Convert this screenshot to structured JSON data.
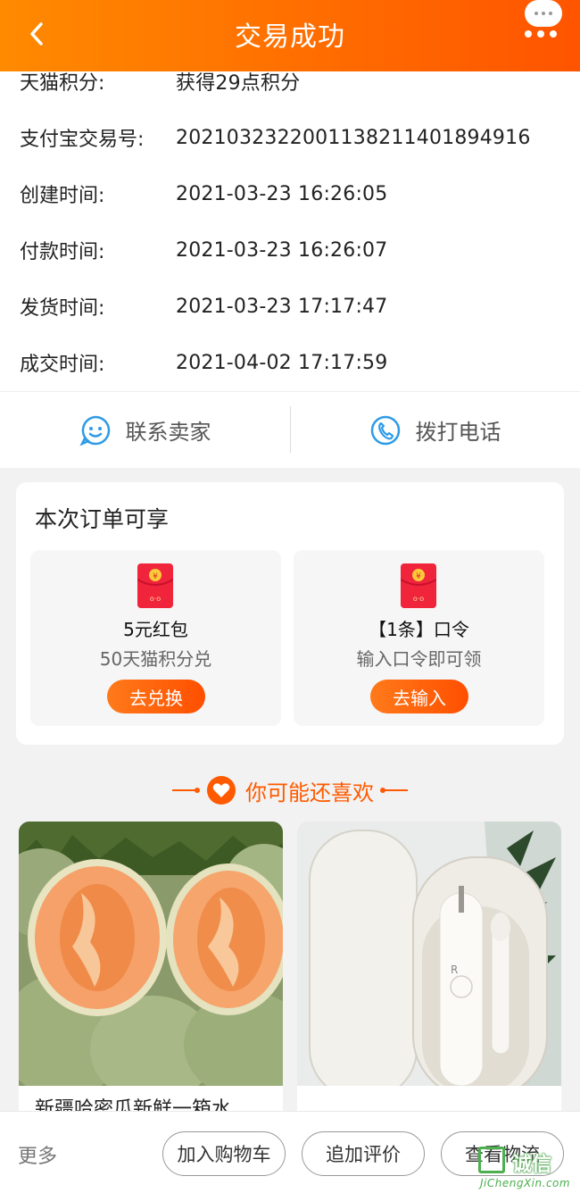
{
  "header": {
    "title": "交易成功"
  },
  "info": {
    "rows": [
      {
        "label": "天猫积分:",
        "value": "获得29点积分"
      },
      {
        "label": "支付宝交易号:",
        "value": "2021032322001138211401894916"
      },
      {
        "label": "创建时间:",
        "value": "2021-03-23 16:26:05"
      },
      {
        "label": "付款时间:",
        "value": "2021-03-23 16:26:07"
      },
      {
        "label": "发货时间:",
        "value": "2021-03-23 17:17:47"
      },
      {
        "label": "成交时间:",
        "value": "2021-04-02 17:17:59"
      }
    ]
  },
  "contact": {
    "seller_label": "联系卖家",
    "phone_label": "拨打电话"
  },
  "benefits": {
    "title": "本次订单可享",
    "items": [
      {
        "name": "5元红包",
        "desc": "50天猫积分兑",
        "action": "去兑换"
      },
      {
        "name": "【1条】口令",
        "desc": "输入口令即可领",
        "action": "去输入"
      }
    ]
  },
  "recommend": {
    "title": "你可能还喜欢",
    "products": [
      {
        "title": "新疆哈密瓜新鲜一箱水"
      },
      {
        "title": ""
      }
    ]
  },
  "bottom_bar": {
    "more": "更多",
    "add_cart": "加入购物车",
    "add_review": "追加评价",
    "view_logistics": "查看物流"
  },
  "watermark": {
    "text": "诚信",
    "url": "JiChengXin.com"
  },
  "colors": {
    "brand_orange": "#ff6a00",
    "accent_red": "#ff4f00",
    "icon_blue": "#2e9be6"
  }
}
